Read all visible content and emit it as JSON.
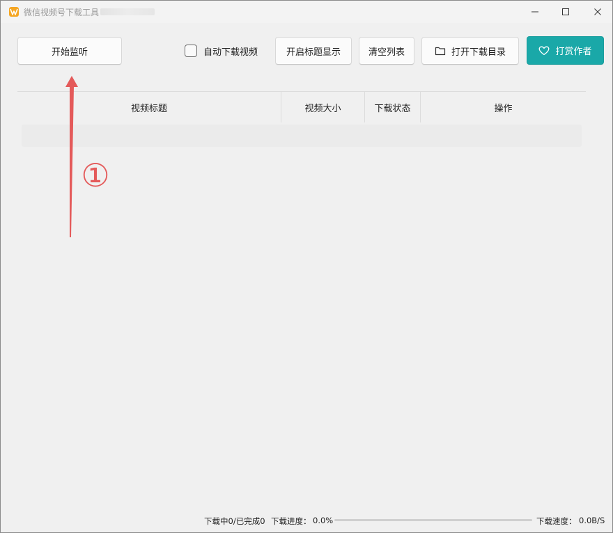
{
  "window": {
    "title": "微信视频号下载工具",
    "controls": [
      "minimize-icon",
      "maximize-icon",
      "close-icon"
    ]
  },
  "toolbar": {
    "start_label": "开始监听",
    "auto_download_label": "自动下载视频",
    "auto_download_checked": false,
    "show_title_label": "开启标题显示",
    "clear_label": "清空列表",
    "open_dir_label": "打开下载目录",
    "donate_label": "打赏作者",
    "donate_color": "#1aa8a8"
  },
  "table": {
    "columns": [
      "视频标题",
      "视频大小",
      "下载状态",
      "操作"
    ],
    "rows": []
  },
  "annotation": {
    "step_number": "①",
    "color": "#e45a5a"
  },
  "status": {
    "downloading": "下载中0/已完成0",
    "progress_label": "下载进度：",
    "progress_value": "0.0%",
    "progress_fraction": 0.0,
    "speed_label": "下载速度：",
    "speed_value": "0.0B/S"
  }
}
